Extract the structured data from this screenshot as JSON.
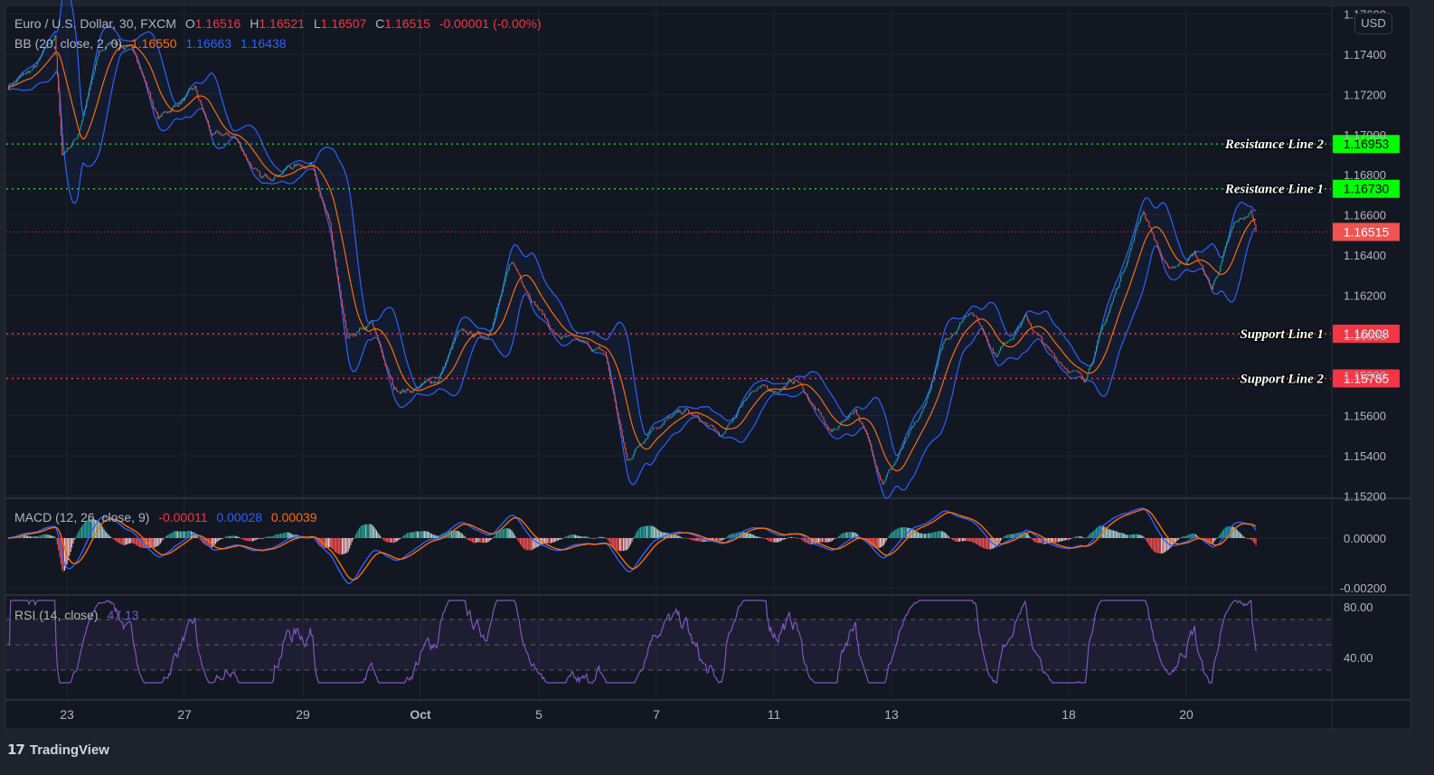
{
  "header": {
    "symbol": "Euro / U.S. Dollar, 30, FXCM",
    "open_label": "O",
    "open": "1.16516",
    "high_label": "H",
    "high": "1.16521",
    "low_label": "L",
    "low": "1.16507",
    "close_label": "C",
    "close": "1.16515",
    "change": "-0.00001 (-0.00%)"
  },
  "bb_legend": {
    "label": "BB (20, close, 2, 0)",
    "basis": "1.16550",
    "upper": "1.16663",
    "lower": "1.16438"
  },
  "macd_legend": {
    "label": "MACD (12, 26, close, 9)",
    "histogram": "-0.00011",
    "macd": "0.00028",
    "signal": "0.00039"
  },
  "rsi_legend": {
    "label": "RSI (14, close)",
    "value": "47.13"
  },
  "currency": "USD",
  "brand": "TradingView",
  "colors": {
    "background": "#131722",
    "up": "#26a69a",
    "down": "#ef5350",
    "bb_band": "#2962ff",
    "bb_basis": "#ff6d00",
    "macd": "#2962ff",
    "signal": "#ff6d00",
    "rsi": "#7e57c2",
    "resistance": "#00ff00",
    "support": "#f23645"
  },
  "chart_data": {
    "type": "candlestick",
    "interval": "30",
    "price_axis": {
      "ticks": [
        "1.17600",
        "1.17400",
        "1.17200",
        "1.17000",
        "1.16800",
        "1.16600",
        "1.16400",
        "1.16200",
        "1.16000",
        "1.15800",
        "1.15600",
        "1.15400",
        "1.15200"
      ],
      "range": [
        1.152,
        1.176
      ]
    },
    "time_axis": {
      "ticks": [
        "23",
        "27",
        "29",
        "Oct",
        "5",
        "7",
        "11",
        "13",
        "18",
        "20"
      ]
    },
    "macd_axis": {
      "ticks": [
        "0.00000",
        "-0.00200"
      ]
    },
    "rsi_axis": {
      "ticks": [
        "80.00",
        "40.00"
      ],
      "bands": [
        30,
        50,
        70
      ]
    },
    "current_price": {
      "value": 1.16515,
      "label": "1.16515"
    },
    "levels": [
      {
        "name": "Resistance Line 2",
        "value": 1.16953,
        "label": "1.16953",
        "kind": "resistance"
      },
      {
        "name": "Resistance Line 1",
        "value": 1.1673,
        "label": "1.16730",
        "kind": "resistance"
      },
      {
        "name": "Support Line 1",
        "value": 1.16008,
        "label": "1.16008",
        "kind": "support"
      },
      {
        "name": "Support Line 2",
        "value": 1.15785,
        "label": "1.15785",
        "kind": "support"
      }
    ],
    "approx_close_path": [
      {
        "t": "Sep 22 00:00",
        "p": 1.1724
      },
      {
        "t": "Sep 22 11:00",
        "p": 1.1733
      },
      {
        "t": "Sep 22 19:00",
        "p": 1.1749
      },
      {
        "t": "Sep 22 22:00",
        "p": 1.169
      },
      {
        "t": "Sep 23 04:00",
        "p": 1.1699
      },
      {
        "t": "Sep 23 13:00",
        "p": 1.174
      },
      {
        "t": "Sep 23 19:00",
        "p": 1.1747
      },
      {
        "t": "Sep 24 04:00",
        "p": 1.174
      },
      {
        "t": "Sep 24 13:00",
        "p": 1.1708
      },
      {
        "t": "Sep 27 04:00",
        "p": 1.1722
      },
      {
        "t": "Sep 27 11:00",
        "p": 1.1699
      },
      {
        "t": "Sep 27 20:00",
        "p": 1.1699
      },
      {
        "t": "Sep 28 07:00",
        "p": 1.1677
      },
      {
        "t": "Sep 28 18:00",
        "p": 1.1684
      },
      {
        "t": "Sep 29 04:00",
        "p": 1.1686
      },
      {
        "t": "Sep 29 11:00",
        "p": 1.1654
      },
      {
        "t": "Sep 29 18:00",
        "p": 1.1596
      },
      {
        "t": "Sep 30 04:00",
        "p": 1.1605
      },
      {
        "t": "Sep 30 13:00",
        "p": 1.1573
      },
      {
        "t": "Sep 30 20:00",
        "p": 1.1573
      },
      {
        "t": "Oct 1 07:00",
        "p": 1.1578
      },
      {
        "t": "Oct 1 15:00",
        "p": 1.16
      },
      {
        "t": "Oct 4 03:00",
        "p": 1.16
      },
      {
        "t": "Oct 4 13:00",
        "p": 1.1636
      },
      {
        "t": "Oct 4 22:00",
        "p": 1.1618
      },
      {
        "t": "Oct 5 07:00",
        "p": 1.16
      },
      {
        "t": "Oct 5 16:00",
        "p": 1.1596
      },
      {
        "t": "Oct 6 03:00",
        "p": 1.1591
      },
      {
        "t": "Oct 6 12:00",
        "p": 1.1537
      },
      {
        "t": "Oct 6 22:00",
        "p": 1.1555
      },
      {
        "t": "Oct 7 12:00",
        "p": 1.1562
      },
      {
        "t": "Oct 8 03:00",
        "p": 1.1549
      },
      {
        "t": "Oct 8 14:00",
        "p": 1.1573
      },
      {
        "t": "Oct 11 01:00",
        "p": 1.1573
      },
      {
        "t": "Oct 11 09:00",
        "p": 1.1578
      },
      {
        "t": "Oct 11 23:00",
        "p": 1.1551
      },
      {
        "t": "Oct 12 09:00",
        "p": 1.1564
      },
      {
        "t": "Oct 12 20:00",
        "p": 1.1528
      },
      {
        "t": "Oct 13 01:00",
        "p": 1.1537
      },
      {
        "t": "Oct 13 12:00",
        "p": 1.156
      },
      {
        "t": "Oct 13 21:00",
        "p": 1.1596
      },
      {
        "t": "Oct 14 08:00",
        "p": 1.1614
      },
      {
        "t": "Oct 14 18:00",
        "p": 1.1591
      },
      {
        "t": "Oct 15 06:00",
        "p": 1.1609
      },
      {
        "t": "Oct 15 16:00",
        "p": 1.1591
      },
      {
        "t": "Oct 18 06:00",
        "p": 1.1578
      },
      {
        "t": "Oct 18 18:00",
        "p": 1.1618
      },
      {
        "t": "Oct 19 06:00",
        "p": 1.1663
      },
      {
        "t": "Oct 19 16:00",
        "p": 1.1632
      },
      {
        "t": "Oct 20 03:00",
        "p": 1.1641
      },
      {
        "t": "Oct 20 10:00",
        "p": 1.1623
      },
      {
        "t": "Oct 20 19:00",
        "p": 1.1654
      },
      {
        "t": "Oct 21 02:00",
        "p": 1.1661
      },
      {
        "t": "Oct 21 04:00",
        "p": 1.16515
      }
    ]
  }
}
